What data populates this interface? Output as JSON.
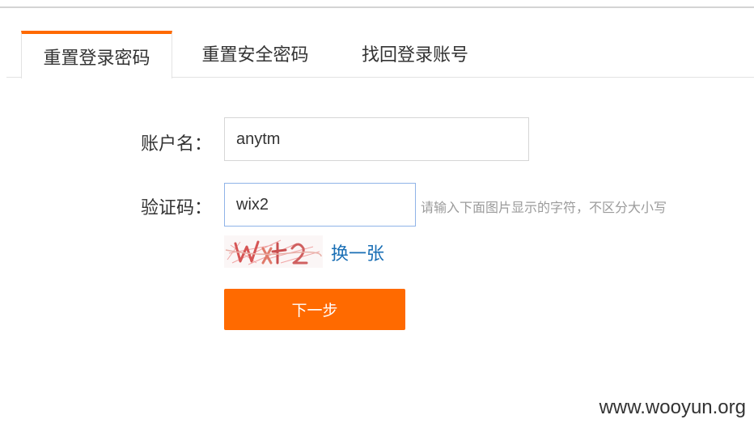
{
  "tabs": [
    {
      "label": "重置登录密码",
      "active": true
    },
    {
      "label": "重置安全密码",
      "active": false
    },
    {
      "label": "找回登录账号",
      "active": false
    }
  ],
  "form": {
    "account": {
      "label": "账户名：",
      "value": "anytm"
    },
    "captcha": {
      "label": "验证码：",
      "value": "wix2",
      "hint": "请输入下面图片显示的字符，不区分大小写",
      "image_text": "wix2",
      "refresh_label": "换一张"
    },
    "next_label": "下一步"
  },
  "watermark": "www.wooyun.org",
  "colors": {
    "accent": "#ff6a00",
    "link": "#1a6fb5",
    "hint": "#9b9b9b"
  }
}
